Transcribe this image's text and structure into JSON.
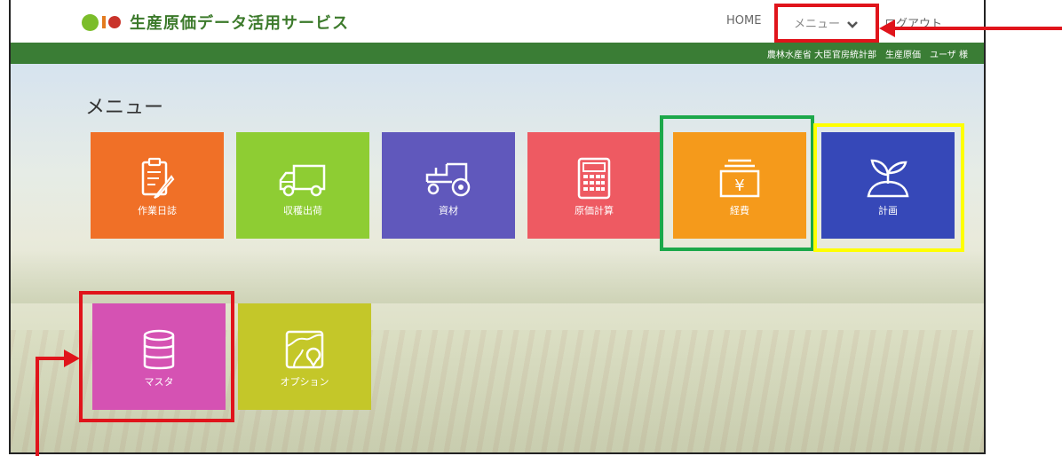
{
  "header": {
    "app_title": "生産原価データ活用サービス",
    "nav": {
      "home": "HOME",
      "menu": "メニュー",
      "logout": "ログアウト"
    },
    "user_info": "農林水産省 大臣官房統計部　生産原価　ユーザ 様"
  },
  "main": {
    "heading": "メニュー",
    "tiles": [
      {
        "label": "作業日誌",
        "icon": "clipboard-pen-icon",
        "color": "#f07027"
      },
      {
        "label": "収穫出荷",
        "icon": "truck-icon",
        "color": "#8ecd33"
      },
      {
        "label": "資材",
        "icon": "tractor-icon",
        "color": "#6058bc"
      },
      {
        "label": "原価計算",
        "icon": "calculator-icon",
        "color": "#ee5a62"
      },
      {
        "label": "経費",
        "icon": "yen-register-icon",
        "color": "#f59a1b"
      },
      {
        "label": "計画",
        "icon": "sprout-icon",
        "color": "#3648b8"
      },
      {
        "label": "マスタ",
        "icon": "database-icon",
        "color": "#d552b3"
      },
      {
        "label": "オプション",
        "icon": "map-pin-icon",
        "color": "#c4c729"
      }
    ]
  },
  "annotation_colors": {
    "red": "#e0141b",
    "green": "#1ca84a",
    "yellow": "#ffff00"
  }
}
